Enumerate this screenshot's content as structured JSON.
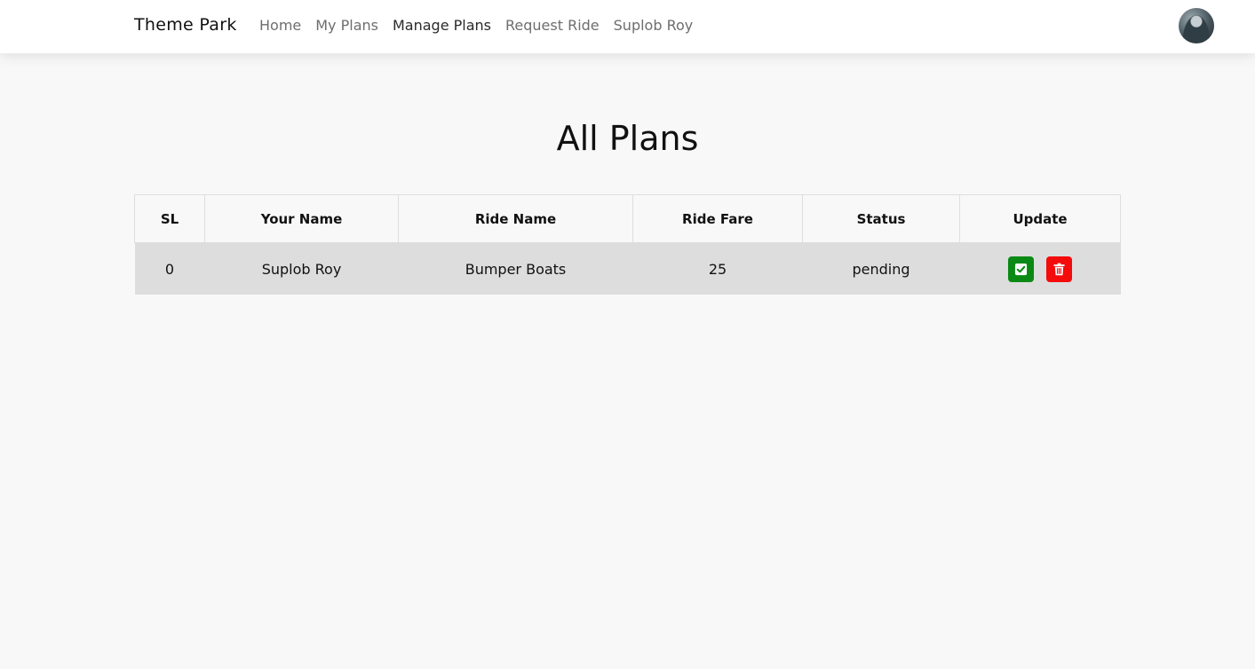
{
  "nav": {
    "brand": "Theme Park",
    "links": [
      {
        "label": "Home"
      },
      {
        "label": "My Plans"
      },
      {
        "label": "Manage Plans"
      },
      {
        "label": "Request Ride"
      },
      {
        "label": "Suplob Roy"
      }
    ],
    "active_link": "Manage Plans",
    "avatar_icon": "user-avatar"
  },
  "page": {
    "title": "All Plans"
  },
  "table": {
    "headers": [
      "SL",
      "Your Name",
      "Ride Name",
      "Ride Fare",
      "Status",
      "Update"
    ],
    "rows": [
      {
        "sl": "0",
        "name": "Suplob Roy",
        "ride": "Bumper Boats",
        "fare": "25",
        "status": "pending",
        "actions": [
          "check-square-icon",
          "trash-icon"
        ]
      }
    ]
  },
  "colors": {
    "approve": "#0a8a14",
    "delete": "#f40b0b",
    "row_bg": "#dddddd",
    "page_bg": "#f8f8f8"
  }
}
